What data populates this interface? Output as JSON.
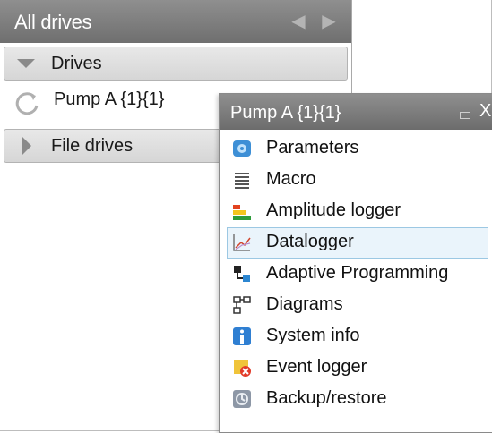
{
  "panel": {
    "title": "All drives",
    "sections": {
      "drives": "Drives",
      "file_drives": "File drives"
    },
    "drive_item": "Pump A {1}{1}"
  },
  "popup": {
    "title": "Pump A {1}{1}",
    "close_glyph": "X",
    "items": [
      {
        "label": "Parameters",
        "icon": "parameters-icon"
      },
      {
        "label": "Macro",
        "icon": "macro-icon"
      },
      {
        "label": "Amplitude logger",
        "icon": "amplitude-logger-icon"
      },
      {
        "label": "Datalogger",
        "icon": "datalogger-icon",
        "selected": true
      },
      {
        "label": "Adaptive Programming",
        "icon": "adaptive-programming-icon"
      },
      {
        "label": "Diagrams",
        "icon": "diagrams-icon"
      },
      {
        "label": "System info",
        "icon": "system-info-icon"
      },
      {
        "label": "Event logger",
        "icon": "event-logger-icon"
      },
      {
        "label": "Backup/restore",
        "icon": "backup-restore-icon"
      }
    ]
  },
  "colors": {
    "header_bg": "#7f7f7f",
    "selection_bg": "#eaf4fb",
    "selection_border": "#9cc8e3"
  }
}
